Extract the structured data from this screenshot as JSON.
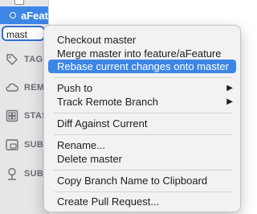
{
  "sidebar": {
    "feature_item": "aFeature",
    "master_item": "mast",
    "sections": [
      {
        "label": "TAGS",
        "icon": "tag-icon"
      },
      {
        "label": "REMO",
        "icon": "cloud-icon"
      },
      {
        "label": "STAS",
        "icon": "stash-icon"
      },
      {
        "label": "SUBI",
        "icon": "submodule-icon"
      },
      {
        "label": "SUBT",
        "icon": "subtree-icon"
      }
    ]
  },
  "menu": {
    "checkout": "Checkout master",
    "merge": "Merge master into feature/aFeature",
    "rebase": "Rebase current changes onto master",
    "push_to": "Push to",
    "track_remote": "Track Remote Branch",
    "diff": "Diff Against Current",
    "rename": "Rename...",
    "delete": "Delete master",
    "copy_name": "Copy Branch Name to Clipboard",
    "create_pr": "Create Pull Request...",
    "submenu_arrow": "▶"
  },
  "colors": {
    "selection": "#3d86e6",
    "menu_bg": "#f2f2f3",
    "sidebar_bg": "#e6e6e9"
  }
}
